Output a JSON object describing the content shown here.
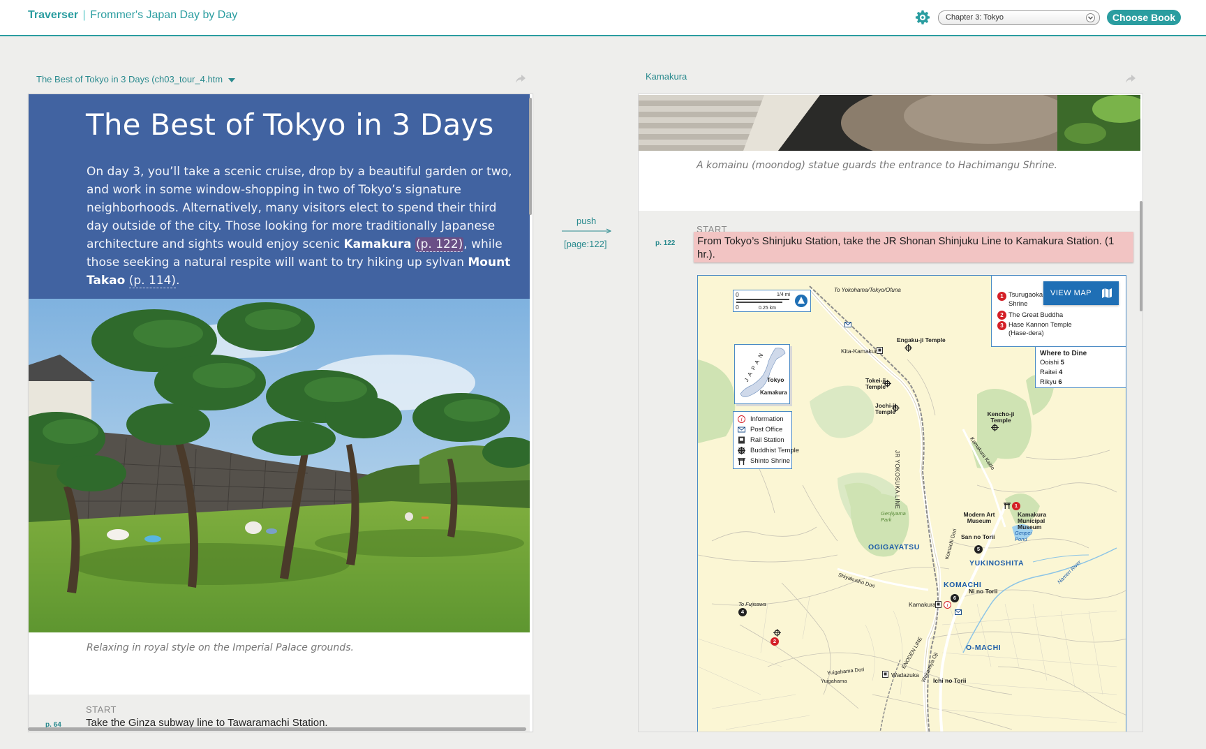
{
  "app": {
    "name": "Traverser",
    "separator": "|",
    "book_title": "Frommer's Japan Day by Day"
  },
  "toolbar": {
    "chapter_selected": "Chapter 3: Tokyo",
    "choose_book_label": "Choose Book"
  },
  "left_pane": {
    "header_title": "The Best of Tokyo in 3 Days (ch03_tour_4.htm",
    "title": "The Best of Tokyo in 3 Days",
    "intro_1": "On day 3, you’ll take a scenic cruise, drop by a beautiful garden or two, and work in some window-shopping in two of Tokyo’s signature neighborhoods. Alternatively, many visitors elect to spend their third day outside of the city. Those looking for more traditionally Japanese architecture and sights would enjoy scenic ",
    "kamakura": "Kamakura",
    "kamakura_ref": "(p. 122)",
    "intro_2": ", while those seeking a natural respite will want to try hiking up sylvan ",
    "takao": "Mount Takao",
    "takao_ref": "(p. 114)",
    "intro_end": ".",
    "photo_caption": "Relaxing in royal style on the Imperial Palace grounds.",
    "start_label": "START",
    "start_page": "p. 64",
    "start_text": "Take the Ginza subway line to Tawaramachi Station."
  },
  "link": {
    "label": "push",
    "target": "[page:122]"
  },
  "right_pane": {
    "header_title": "Kamakura",
    "photo_caption": "A komainu (moondog) statue guards the entrance to Hachimangu Shrine.",
    "start_label": "START",
    "start_page": "p. 122",
    "start_text": "From Tokyo’s Shinjuku Station, take the JR Shonan Shinjuku Line to Kamakura Station. (1 hr.).",
    "map": {
      "view_map_label": "VIEW MAP",
      "scale_mi": "1/4 mi",
      "scale_km": "0.25 km",
      "scale_zero": "0",
      "inset_country": "JAPAN",
      "inset_tokyo": "Tokyo",
      "inset_kamakura": "Kamakura",
      "key": [
        {
          "n": "1",
          "label": "Tsurugaoka",
          "label2": "Shrine"
        },
        {
          "n": "2",
          "label": "The Great Buddha"
        },
        {
          "n": "3",
          "label": "Hase Kannon Temple",
          "label2": "(Hase-dera)"
        }
      ],
      "dine_title": "Where to Dine",
      "dine": [
        {
          "name": "Ooishi",
          "n": "5"
        },
        {
          "name": "Raitei",
          "n": "4"
        },
        {
          "name": "Rikyu",
          "n": "6"
        }
      ],
      "legend": [
        "Information",
        "Post Office",
        "Rail Station",
        "Buddhist Temple",
        "Shinto Shrine"
      ],
      "labels": {
        "yokohama": "To Yokohama/Tokyo/Ofuna",
        "engakuji": "Engaku-ji Temple",
        "kitakamakura": "Kita-Kamakura",
        "tokeiji": "Tokei-ji Temple",
        "jochiji": "Jochi-ji Temple",
        "kenchoji": "Kencho-ji Temple",
        "kamakura_kaido": "Kamakura Kaido",
        "jr_yokosuka": "JR YOKOSUKA LINE",
        "genjiyama": "Genjiyama Park",
        "modern_art": "Modern Art Museum",
        "municipal": "Kamakura Municipal Museum",
        "genpei": "Genpei Pond",
        "sannotorii": "San no Torii",
        "ogigayatsu": "OGIGAYATSU",
        "yukinoshita": "YUKINOSHITA",
        "komachi": "KOMACHI",
        "komachi_dori": "Komachi Dori",
        "ninotorii": "Ni no Torii",
        "nameri": "Nameri River",
        "shiyakusho": "Shiyakusho Dori",
        "fujisawa": "To Fujisawa",
        "kamakura_station": "Kamakura",
        "omachi": "O-MACHI",
        "enoden": "ENODEN LINE",
        "wakamiya": "Wakamiya Oji",
        "yuigahama_dori": "Yuigahama Dori",
        "wadazuka": "Wadazuka",
        "ichinotorii": "Ichi no Torii",
        "yuigahama": "Yuigahama"
      }
    }
  },
  "colors": {
    "accent": "#2a9da0",
    "hero_blue": "#4163a1",
    "start_highlight": "#f2c4c3",
    "map_bg": "#fbf6d4"
  }
}
